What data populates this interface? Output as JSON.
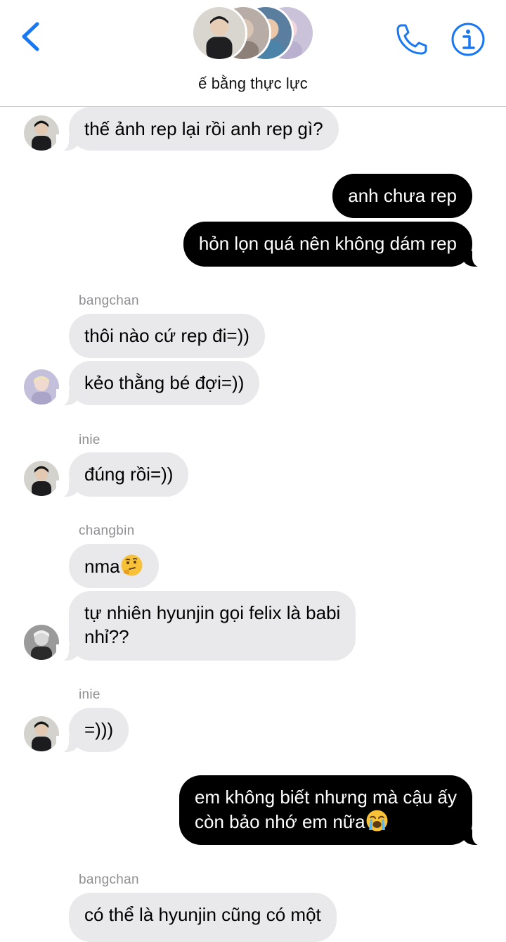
{
  "header": {
    "group_name": "ế bằng thực lực",
    "back_icon": "chevron-left-icon",
    "call_icon": "phone-icon",
    "info_icon": "info-icon",
    "accent_color": "#1877f2"
  },
  "messages": [
    {
      "id": "m1",
      "direction": "incoming",
      "sender": "",
      "avatar": "dark-hair-person-avatar",
      "text": "thế ảnh rep lại rồi anh rep gì?"
    },
    {
      "id": "m2",
      "direction": "outgoing",
      "text": "anh chưa rep"
    },
    {
      "id": "m3",
      "direction": "outgoing",
      "text": "hỏn lọn quá nên không dám rep"
    },
    {
      "id": "m4",
      "direction": "incoming",
      "sender": "bangchan",
      "text": "thôi nào cứ rep đi=))"
    },
    {
      "id": "m5",
      "direction": "incoming",
      "sender": "",
      "avatar": "blond-person-avatar",
      "text": "kẻo thằng bé đợi=))"
    },
    {
      "id": "m6",
      "direction": "incoming",
      "sender": "inie",
      "avatar": "dark-hair-person-avatar",
      "text": "đúng rồi=))"
    },
    {
      "id": "m7",
      "direction": "incoming",
      "sender": "changbin",
      "text": "nma",
      "emoji": "thinking-face-emoji"
    },
    {
      "id": "m8",
      "direction": "incoming",
      "sender": "",
      "avatar": "black-white-person-avatar",
      "line1": "tự nhiên hyunjin gọi felix là babi",
      "line2": "nhỉ??"
    },
    {
      "id": "m9",
      "direction": "incoming",
      "sender": "inie",
      "avatar": "dark-hair-person-avatar",
      "text": "=)))"
    },
    {
      "id": "m10",
      "direction": "outgoing",
      "line1": "em không biết nhưng mà cậu ấy",
      "line2": "còn bảo nhớ em nữa",
      "emoji": "loudly-crying-face-emoji"
    },
    {
      "id": "m11",
      "direction": "incoming",
      "sender": "bangchan",
      "text": "có thể là hyunjin cũng có một"
    }
  ],
  "colors": {
    "incoming_bubble": "#e9e9eb",
    "outgoing_bubble": "#000000",
    "sender_label": "#8e8e93"
  }
}
